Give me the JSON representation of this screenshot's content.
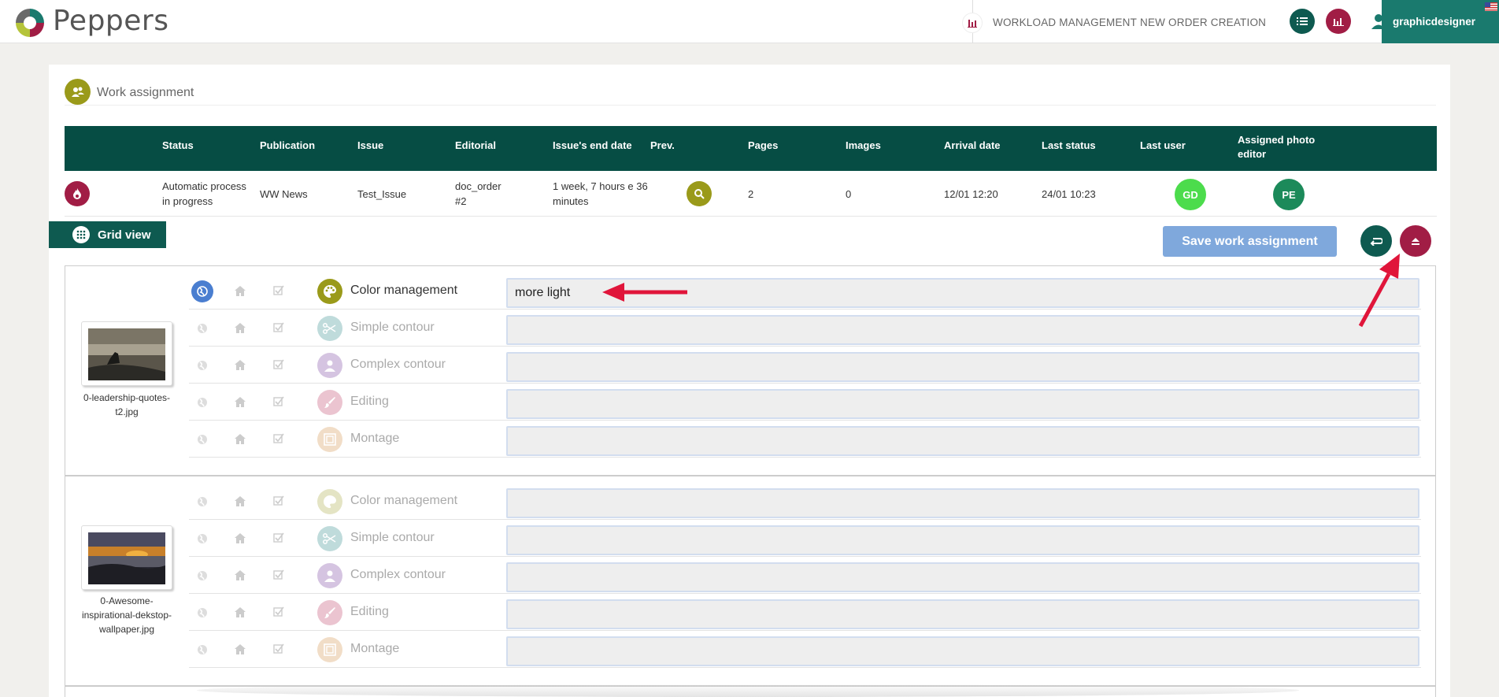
{
  "header": {
    "brand": "Peppers",
    "nav": [
      {
        "label": "WORKLOAD MANAGEMENT"
      },
      {
        "label": "NEW ORDER CREATION"
      }
    ],
    "user": "graphicdesigner",
    "icons": {
      "list": "list-icon",
      "chart": "chart-icon",
      "user": "user-icon",
      "flag": "us-flag-icon"
    }
  },
  "panel": {
    "title": "Work assignment"
  },
  "table": {
    "headers": [
      "Status",
      "Publication",
      "Issue",
      "Editorial",
      "Issue's end date",
      "Prev.",
      "Pages",
      "Images",
      "Arrival date",
      "Last status",
      "Last user",
      "Assigned photo editor"
    ],
    "row": {
      "status": "Automatic process in progress",
      "publication": "WW News",
      "issue": "Test_Issue",
      "editorial": "doc_order #2",
      "end_date": "1 week, 7 hours e 36 minutes",
      "pages": "2",
      "images": "0",
      "arrival": "12/01 12:20",
      "last_status": "24/01 10:23",
      "last_user": "GD",
      "photo_editor": "PE"
    }
  },
  "toolbar": {
    "grid_view": "Grid view",
    "save": "Save work assignment"
  },
  "images": [
    {
      "filename": "0-leadership-quotes-t2.jpg",
      "tasks": [
        {
          "label": "Color management",
          "value": "more light",
          "active": true
        },
        {
          "label": "Simple contour",
          "value": "",
          "active": false
        },
        {
          "label": "Complex contour",
          "value": "",
          "active": false
        },
        {
          "label": "Editing",
          "value": "",
          "active": false
        },
        {
          "label": "Montage",
          "value": "",
          "active": false
        }
      ]
    },
    {
      "filename": "0-Awesome-inspirational-dekstop-wallpaper.jpg",
      "tasks": [
        {
          "label": "Color management",
          "value": "",
          "active": false
        },
        {
          "label": "Simple contour",
          "value": "",
          "active": false
        },
        {
          "label": "Complex contour",
          "value": "",
          "active": false
        },
        {
          "label": "Editing",
          "value": "",
          "active": false
        },
        {
          "label": "Montage",
          "value": "",
          "active": false
        }
      ]
    }
  ],
  "colors": {
    "teal_dark": "#064d44",
    "teal": "#1a7a6e",
    "maroon": "#a11d45",
    "olive": "#9a9a1a",
    "save_blue": "#7fa8dc",
    "annotation_red": "#e0153a"
  }
}
